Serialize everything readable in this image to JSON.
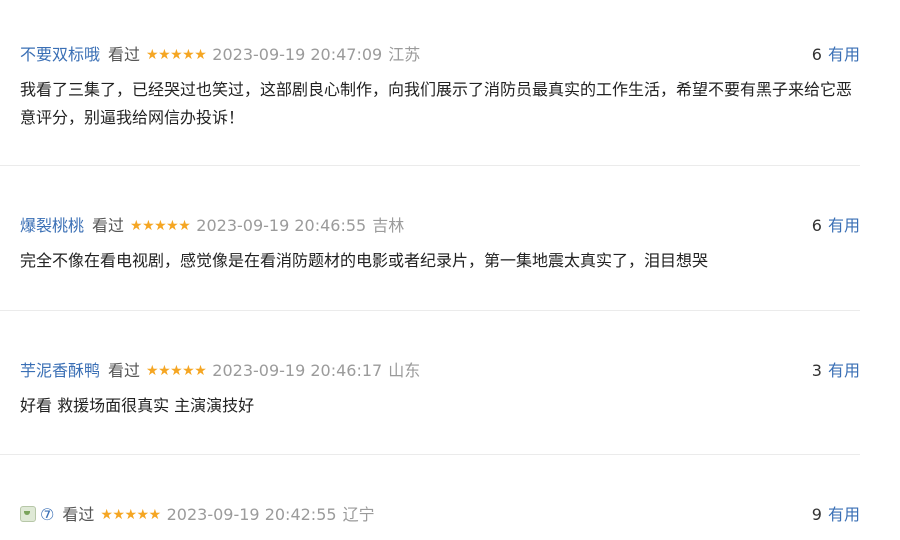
{
  "comments": [
    {
      "user": "不要双标哦",
      "status": "看过",
      "stars": "★★★★★",
      "time": "2023-09-19 20:47:09",
      "location": "江苏",
      "useful_count": "6",
      "useful_label": "有用",
      "text": "我看了三集了，已经哭过也笑过，这部剧良心制作，向我们展示了消防员最真实的工作生活，希望不要有黑子来给它恶意评分，别逼我给网信办投诉！"
    },
    {
      "user": "爆裂桃桃",
      "status": "看过",
      "stars": "★★★★★",
      "time": "2023-09-19 20:46:55",
      "location": "吉林",
      "useful_count": "6",
      "useful_label": "有用",
      "text": "完全不像在看电视剧，感觉像是在看消防题材的电影或者纪录片，第一集地震太真实了，泪目想哭"
    },
    {
      "user": "芋泥香酥鸭",
      "status": "看过",
      "stars": "★★★★★",
      "time": "2023-09-19 20:46:17",
      "location": "山东",
      "useful_count": "3",
      "useful_label": "有用",
      "text": "好看 救援场面很真实 主演演技好"
    },
    {
      "user": "⑦",
      "user_icon": "tea-cup-icon",
      "status": "看过",
      "stars": "★★★★★",
      "time": "2023-09-19 20:42:55",
      "location": "辽宁",
      "useful_count": "9",
      "useful_label": "有用",
      "text": ""
    }
  ],
  "colors": {
    "username": "#3a6fb5",
    "stars": "#f5a623",
    "meta_gray": "#9b9b9b",
    "divider": "#ebebeb"
  }
}
